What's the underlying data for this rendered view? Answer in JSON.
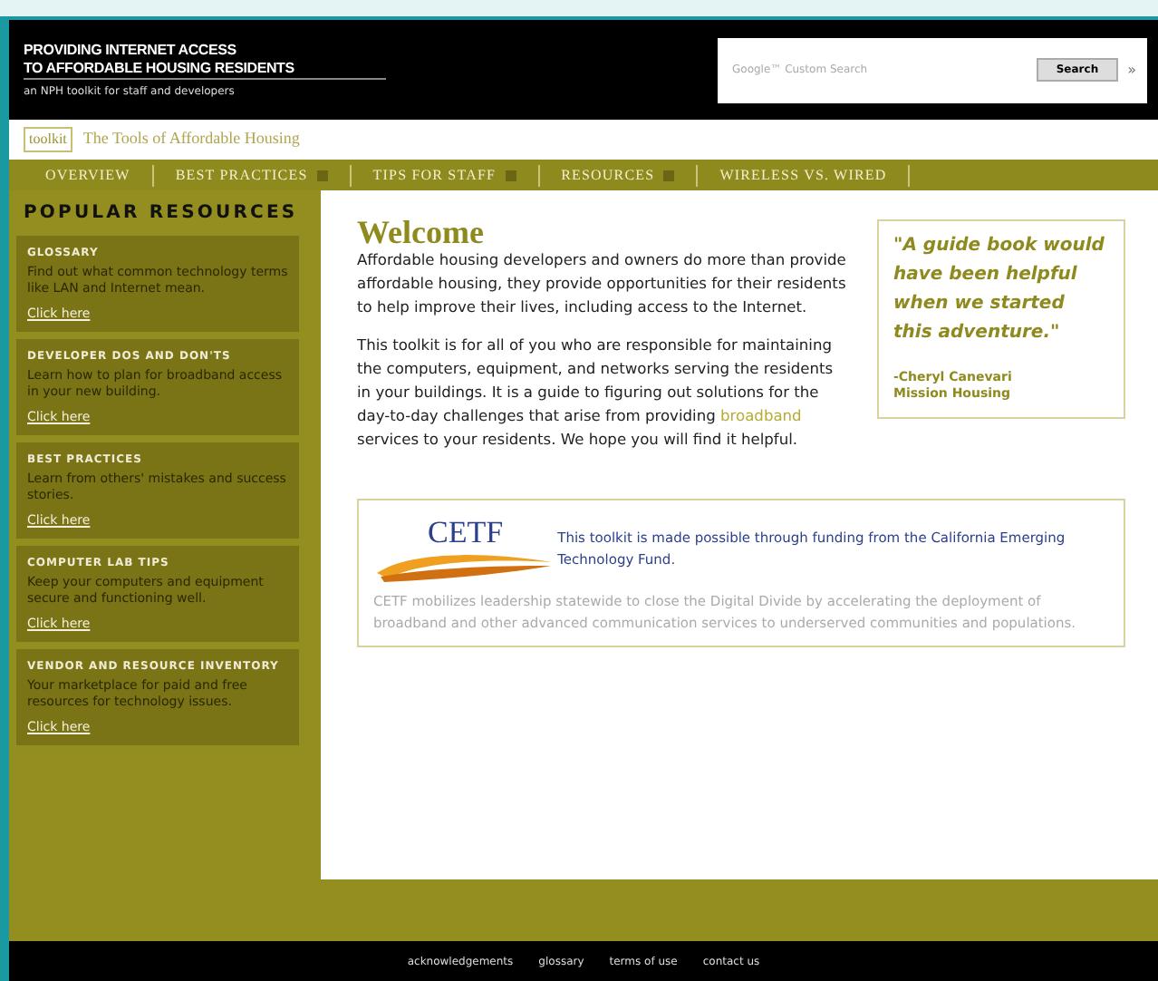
{
  "header": {
    "title_lines": [
      "PROVIDING INTERNET ACCESS",
      "TO AFFORDABLE HOUSING RESIDENTS"
    ],
    "subtitle": "an NPH toolkit for staff and developers",
    "search": {
      "placeholder": "Google™ Custom Search",
      "button": "Search",
      "extra": "»"
    }
  },
  "tagline": {
    "logo": "toolkit",
    "text": "The Tools of Affordable Housing"
  },
  "nav": [
    {
      "label": "OVERVIEW",
      "dropdown": false
    },
    {
      "label": "BEST PRACTICES",
      "dropdown": true
    },
    {
      "label": "TIPS FOR STAFF",
      "dropdown": true
    },
    {
      "label": "RESOURCES",
      "dropdown": true
    },
    {
      "label": "WIRELESS VS. WIRED",
      "dropdown": false
    }
  ],
  "sidebar": {
    "title": "POPULAR RESOURCES",
    "items": [
      {
        "title": "GLOSSARY",
        "text": "Find out what common technology terms like LAN and Internet mean.",
        "link": "Click here"
      },
      {
        "title": "DEVELOPER DOS AND DON'TS",
        "text": "Learn how to plan for broadband access in your new building.",
        "link": "Click here"
      },
      {
        "title": "BEST PRACTICES",
        "text": "Learn from others' mistakes and success stories.",
        "link": "Click here"
      },
      {
        "title": "COMPUTER LAB TIPS",
        "text": "Keep your computers and equipment secure and functioning well.",
        "link": "Click here"
      },
      {
        "title": "VENDOR AND RESOURCE INVENTORY",
        "text": "Your marketplace for paid and free resources for technology issues.",
        "link": "Click here"
      }
    ]
  },
  "main": {
    "heading": "Welcome",
    "paragraphs": [
      [
        {
          "text": "Affordable housing developers and owners do more than provide affordable housing, they provide opportunities for their residents to help improve their lives, including access to the Internet."
        }
      ],
      [
        {
          "text": "This toolkit is for all of you who are responsible for maintaining the computers, equipment, and networks serving the residents in your buildings. It is a guide to figuring out solutions for the day-to-day challenges that arise from providing "
        },
        {
          "text": "broadband",
          "link": true
        },
        {
          "text": " services to your residents. We hope you will find it helpful."
        }
      ]
    ],
    "quote": {
      "text": "\"A guide book would have been helpful when we started this adventure.\"",
      "author": "-Cheryl Canevari",
      "org": "Mission Housing"
    },
    "sponsor": {
      "logo": "CETF",
      "lead": "This toolkit is made possible through funding from the California Emerging Technology Fund.",
      "text": "CETF mobilizes leadership statewide to close the Digital Divide by accelerating the deployment of broadband and other advanced communication services to underserved communities and populations."
    }
  },
  "footer": [
    "acknowledgements",
    "glossary",
    "terms of use",
    "contact us"
  ]
}
